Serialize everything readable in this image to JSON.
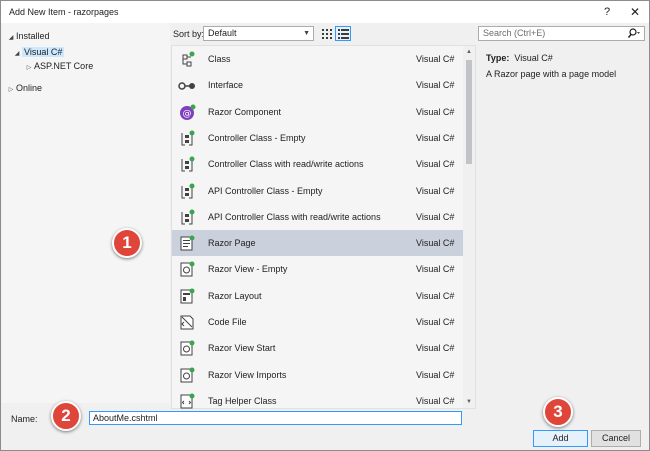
{
  "window": {
    "title": "Add New Item - razorpages",
    "help_glyph": "?",
    "close_glyph": "✕"
  },
  "tree": {
    "installed": "Installed",
    "visual_csharp": "Visual C#",
    "aspnet_core": "ASP.NET Core",
    "online": "Online"
  },
  "toolbar": {
    "sort_label": "Sort by:",
    "sort_value": "Default",
    "search_placeholder": "Search (Ctrl+E)"
  },
  "templates": [
    {
      "name": "Class",
      "lang": "Visual C#",
      "icon": "class-icon"
    },
    {
      "name": "Interface",
      "lang": "Visual C#",
      "icon": "interface-icon"
    },
    {
      "name": "Razor Component",
      "lang": "Visual C#",
      "icon": "razor-component-icon"
    },
    {
      "name": "Controller Class - Empty",
      "lang": "Visual C#",
      "icon": "controller-icon"
    },
    {
      "name": "Controller Class with read/write actions",
      "lang": "Visual C#",
      "icon": "controller-icon"
    },
    {
      "name": "API Controller Class - Empty",
      "lang": "Visual C#",
      "icon": "controller-icon"
    },
    {
      "name": "API Controller Class with read/write actions",
      "lang": "Visual C#",
      "icon": "controller-icon"
    },
    {
      "name": "Razor Page",
      "lang": "Visual C#",
      "icon": "razor-page-icon",
      "selected": true
    },
    {
      "name": "Razor View - Empty",
      "lang": "Visual C#",
      "icon": "razor-view-icon"
    },
    {
      "name": "Razor Layout",
      "lang": "Visual C#",
      "icon": "razor-layout-icon"
    },
    {
      "name": "Code File",
      "lang": "Visual C#",
      "icon": "code-file-icon"
    },
    {
      "name": "Razor View Start",
      "lang": "Visual C#",
      "icon": "razor-view-icon"
    },
    {
      "name": "Razor View Imports",
      "lang": "Visual C#",
      "icon": "razor-view-icon"
    },
    {
      "name": "Tag Helper Class",
      "lang": "Visual C#",
      "icon": "tag-helper-icon"
    }
  ],
  "details": {
    "type_label": "Type:",
    "type_value": "Visual C#",
    "description": "A Razor page with a page model"
  },
  "footer": {
    "name_label": "Name:",
    "name_value": "AboutMe.cshtml",
    "add_label": "Add",
    "cancel_label": "Cancel"
  },
  "callouts": {
    "one": "1",
    "two": "2",
    "three": "3"
  },
  "colors": {
    "selected_row": "#cbd1dc",
    "focus_border": "#3399ff",
    "callout": "#e0453a",
    "accent_green": "#3fa34d",
    "razor_purple": "#7f3fbf"
  }
}
